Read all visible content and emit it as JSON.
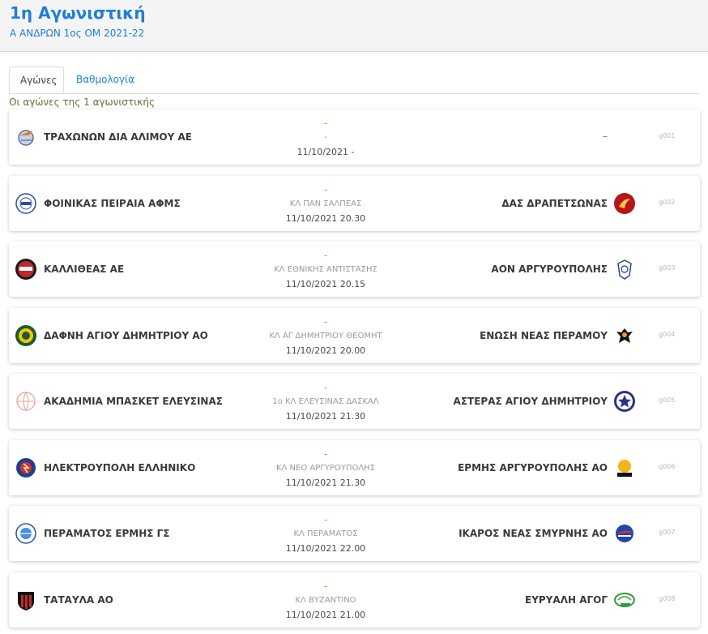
{
  "header": {
    "title": "1η Αγωνιστική",
    "subtitle": "Α ΑΝΔΡΩΝ 1ος ΟΜ 2021-22"
  },
  "tabs": [
    {
      "label": "Αγώνες",
      "active": true
    },
    {
      "label": "Βαθμολογία",
      "active": false
    }
  ],
  "intro": "Οι αγώνες της 1 αγωνιστικής",
  "colors": {
    "accent": "#1e7fd6",
    "score": "#b9a300"
  },
  "matches": [
    {
      "home": "ΤΡΑΧΩΝΩΝ ΔΙΑ ΑΛΙΜΟΥ ΑΕ",
      "away": "",
      "away_placeholder": "–",
      "score": "-",
      "venue": "-",
      "datetime": "11/10/2021 -",
      "code": "g001",
      "home_icon": "basketball-bird-logo",
      "away_icon": ""
    },
    {
      "home": "ΦΟΙΝΙΚΑΣ ΠΕΙΡΑΙΑ ΑΦΜΣ",
      "away": "ΔΑΣ ΔΡΑΠΕΤΣΩΝΑΣ",
      "score": "-",
      "venue": "ΚΛ ΠΑΝ ΣΑΛΠΕΑΣ",
      "datetime": "11/10/2021 20.30",
      "code": "g002",
      "home_icon": "phoenix-1949-logo",
      "away_icon": "red-bird-logo"
    },
    {
      "home": "ΚΑΛΛΙΘΕΑΣ ΑΕ",
      "away": "ΑΟΝ ΑΡΓΥΡΟΥΠΟΛΗΣ",
      "score": "-",
      "venue": "ΚΛ ΕΘΝΙΚΗΣ ΑΝΤΙΣΤΑΣΗΣ",
      "datetime": "11/10/2021 20.15",
      "code": "g003",
      "home_icon": "kallithea-logo",
      "away_icon": "aon-crest-logo"
    },
    {
      "home": "ΔΑΦΝΗ ΑΓΙΟΥ ΔΗΜΗΤΡΙΟΥ ΑΟ",
      "away": "ΕΝΩΣΗ ΝΕΑΣ ΠΕΡΑΜΟΥ",
      "score": "-",
      "venue": "ΚΛ ΑΓ ΔΗΜΗΤΡΙΟΥ ΘΕΟΜΗΤ",
      "datetime": "11/10/2021 20.00",
      "code": "g004",
      "home_icon": "dafni-logo",
      "away_icon": "eagle-logo"
    },
    {
      "home": "ΑΚΑΔΗΜΙΑ ΜΠΑΣΚΕΤ ΕΛΕΥΣΙΝΑΣ",
      "away": "ΑΣΤΕΡΑΣ ΑΓΙΟΥ ΔΗΜΗΤΡΙΟΥ",
      "score": "-",
      "venue": "1ο ΚΛ ΕΛΕΥΣΙΝΑΣ ΔΑΣΚΑΛ",
      "datetime": "11/10/2021 21.30",
      "code": "g005",
      "home_icon": "academy-ball-logo",
      "away_icon": "star-logo"
    },
    {
      "home": "ΗΛΕΚΤΡΟΥΠΟΛΗ ΕΛΛΗΝΙΚΟ",
      "away": "ΕΡΜΗΣ ΑΡΓΥΡΟΥΠΟΛΗΣ ΑΟ",
      "score": "-",
      "venue": "ΚΛ ΝΕΟ ΑΡΓΥΡΟΥΠΟΛΗΣ",
      "datetime": "11/10/2021 21.30",
      "code": "g006",
      "home_icon": "ilektroupoli-logo",
      "away_icon": "ermis-logo"
    },
    {
      "home": "ΠΕΡΑΜΑΤΟΣ ΕΡΜΗΣ ΓΣ",
      "away": "ΙΚΑΡΟΣ ΝΕΑΣ ΣΜΥΡΝΗΣ ΑΟ",
      "score": "-",
      "venue": "ΚΛ ΠΕΡΑΜΑΤΟΣ",
      "datetime": "11/10/2021 22.00",
      "code": "g007",
      "home_icon": "perama-ball-logo",
      "away_icon": "ikaros-logo"
    },
    {
      "home": "ΤΑΤΑΥΛΑ ΑΟ",
      "away": "ΕΥΡΥΑΛΗ ΑΓΟΓ",
      "score": "-",
      "venue": "ΚΛ ΒΥΖΑΝΤΙΝΟ",
      "datetime": "11/10/2021 21.00",
      "code": "g008",
      "home_icon": "tatavla-shield-logo",
      "away_icon": "evryali-logo"
    }
  ]
}
